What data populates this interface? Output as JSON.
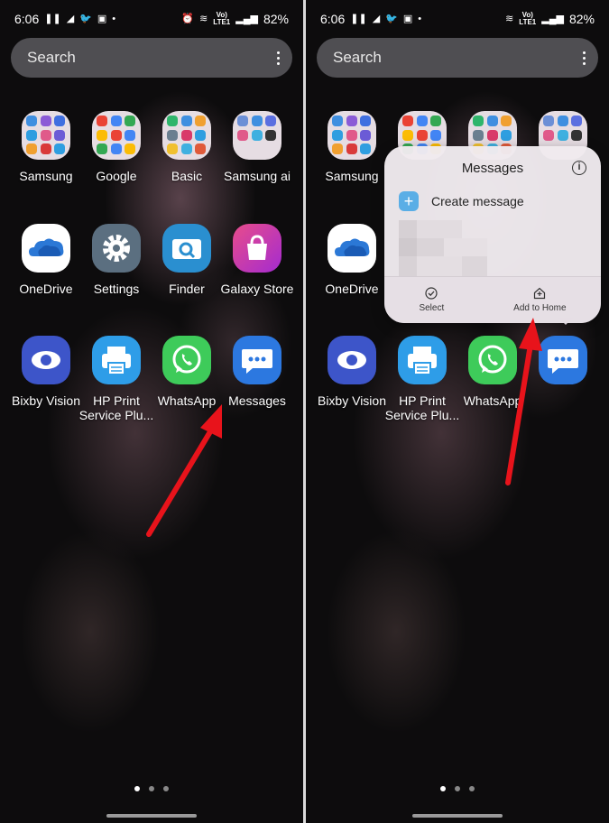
{
  "status_bar": {
    "time": "6:06",
    "battery": "82%",
    "network_top": "Vo)",
    "network_bottom": "LTE1"
  },
  "search": {
    "placeholder": "Search"
  },
  "apps": {
    "samsung": "Samsung",
    "google": "Google",
    "basic": "Basic",
    "samsung_ai": "Samsung ai",
    "onedrive": "OneDrive",
    "settings": "Settings",
    "finder": "Finder",
    "galaxy_store": "Galaxy Store",
    "bixby_vision": "Bixby Vision",
    "hp_print": "HP Print Service Plu...",
    "whatsapp": "WhatsApp",
    "messages": "Messages"
  },
  "right_apps": {
    "whatsapp": "WhatsApp"
  },
  "popup": {
    "title": "Messages",
    "create_message": "Create message",
    "select": "Select",
    "add_to_home": "Add to Home"
  },
  "colors": {
    "arrow": "#e8131b",
    "onedrive": "#2b78d6",
    "settings": "#5b6f80",
    "finder": "#2a8fd0",
    "galaxy_store": "#e03a8f",
    "bixby": "#3d55c9",
    "hp_print": "#2e9de8",
    "whatsapp": "#3ecb5a",
    "messages": "#2c78e0"
  }
}
